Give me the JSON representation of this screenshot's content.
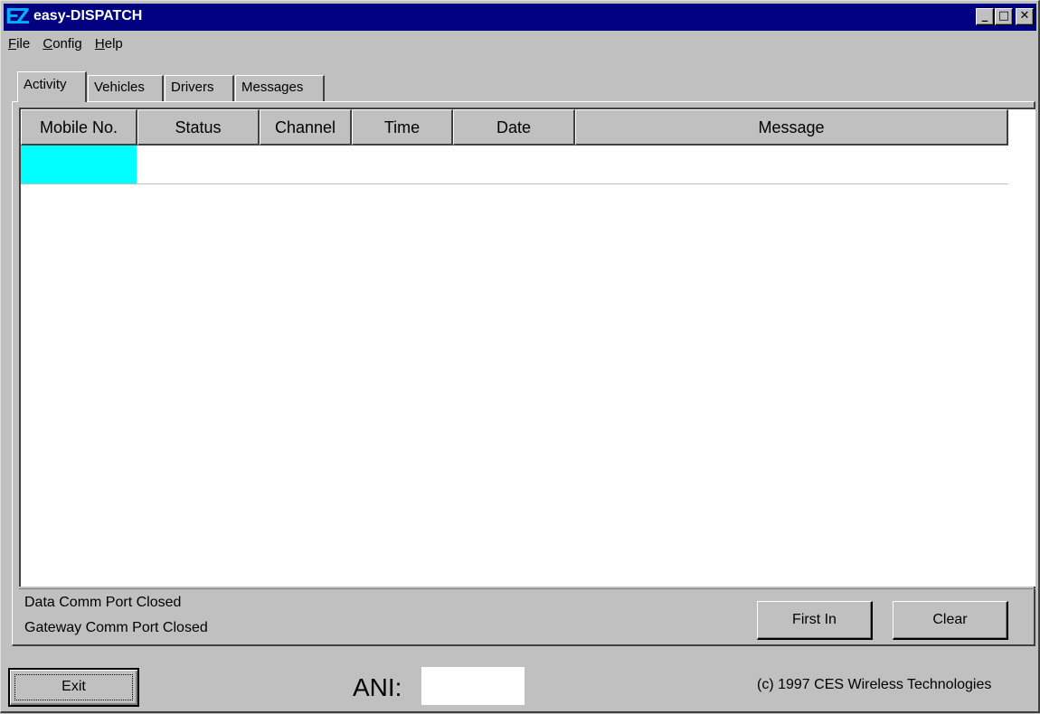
{
  "window": {
    "logo": "EZ",
    "title": "easy-DISPATCH",
    "controls": {
      "minimize": "_",
      "maximize": "□",
      "close": "✕"
    }
  },
  "menu": [
    "File",
    "Config",
    "Help"
  ],
  "tabs": [
    "Activity",
    "Vehicles",
    "Drivers",
    "Messages"
  ],
  "grid": {
    "columns": [
      "Mobile No.",
      "Status",
      "Channel",
      "Time",
      "Date",
      "Message"
    ],
    "rows": [
      {
        "mobile_no": "",
        "status": "",
        "channel": "",
        "time": "",
        "date": "",
        "message": "",
        "selected_cell_color": "#00ffff"
      }
    ]
  },
  "status": {
    "data_port": "Data Comm Port Closed",
    "gateway_port": "Gateway Comm Port Closed"
  },
  "buttons": {
    "first_in": "First In",
    "clear": "Clear",
    "exit": "Exit"
  },
  "ani": {
    "label": "ANI:",
    "value": ""
  },
  "copyright": "(c) 1997 CES Wireless Technologies",
  "colors": {
    "titlebar": "#000080",
    "face": "#c0c0c0",
    "selection": "#00ffff"
  }
}
